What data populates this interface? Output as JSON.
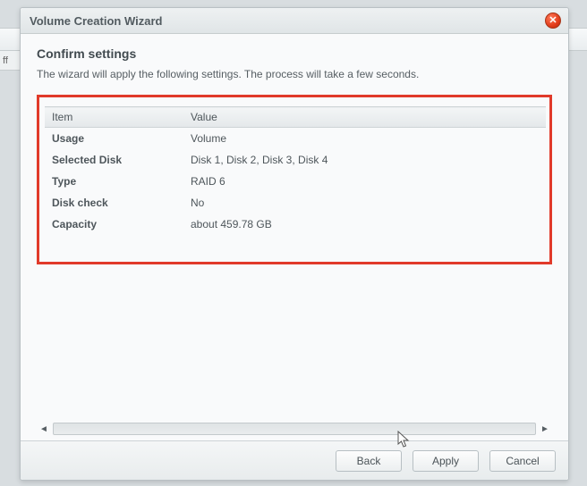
{
  "bg": {
    "fragment": "ff"
  },
  "titlebar": {
    "title": "Volume Creation Wizard"
  },
  "page": {
    "heading": "Confirm settings",
    "subtext": "The wizard will apply the following settings. The process will take a few seconds."
  },
  "table": {
    "headers": {
      "item": "Item",
      "value": "Value"
    },
    "rows": [
      {
        "key": "Usage",
        "value": "Volume"
      },
      {
        "key": "Selected Disk",
        "value": "Disk 1, Disk 2, Disk 3, Disk 4"
      },
      {
        "key": "Type",
        "value": "RAID 6"
      },
      {
        "key": "Disk check",
        "value": "No"
      },
      {
        "key": "Capacity",
        "value": "about 459.78 GB"
      }
    ]
  },
  "buttons": {
    "back": "Back",
    "apply": "Apply",
    "cancel": "Cancel"
  }
}
